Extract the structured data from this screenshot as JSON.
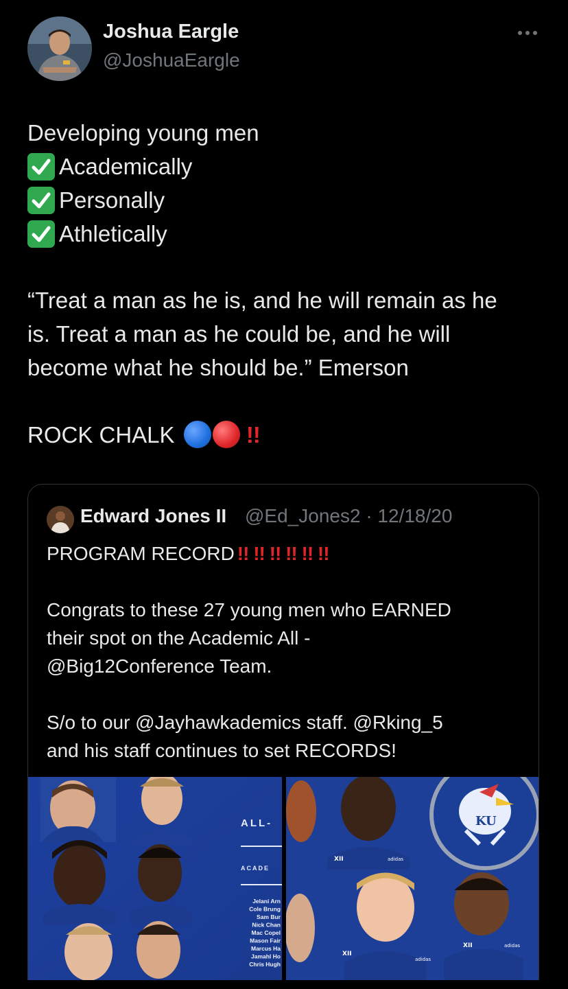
{
  "tweet": {
    "author": {
      "name": "Joshua Eargle",
      "handle": "@JoshuaEargle"
    },
    "more_label": "···",
    "lines": {
      "intro": "Developing young men",
      "check1": "Academically",
      "check2": "Personally",
      "check3": "Athletically",
      "quote1": "“Treat a man as he is, and he will remain as he",
      "quote2": "is. Treat a man as he could be, and he will",
      "quote3": "become what he should be.” Emerson",
      "rock": "ROCK CHALK",
      "rock_bang": "!!"
    },
    "colors": {
      "blue_circle": "#1f6fe0",
      "red_circle": "#e0262a",
      "check_green": "#2fa84f"
    }
  },
  "quoted_tweet": {
    "author": {
      "name": "Edward Jones II",
      "handle": "@Ed_Jones2",
      "date": "12/18/20",
      "meta": "@Ed_Jones2 · 12/18/20"
    },
    "lines": {
      "l1": "PROGRAM RECORD",
      "l1_bangs": "!! !! !! !! !! !!",
      "l2": "Congrats to these 27 young men who EARNED",
      "l3": "their spot on the Academic All -",
      "l4": "@Big12Conference Team.",
      "l5": "S/o to our @Jayhawkademics staff. @Rking_5",
      "l6": "and his staff continues to set RECORDS!"
    },
    "images": {
      "left": {
        "heading": "ALL-",
        "subheading": "ACADE",
        "names": [
          "Jelani Arn",
          "Cole Brung",
          "Sam Bur",
          "Nick Chan",
          "Mac Copel",
          "Mason Fair",
          "Marcus Ha",
          "Jamahl Ho",
          "Chris Hugh"
        ]
      },
      "right": {
        "logo_text": "KU",
        "badges": [
          "XII",
          "adidas"
        ]
      }
    }
  }
}
